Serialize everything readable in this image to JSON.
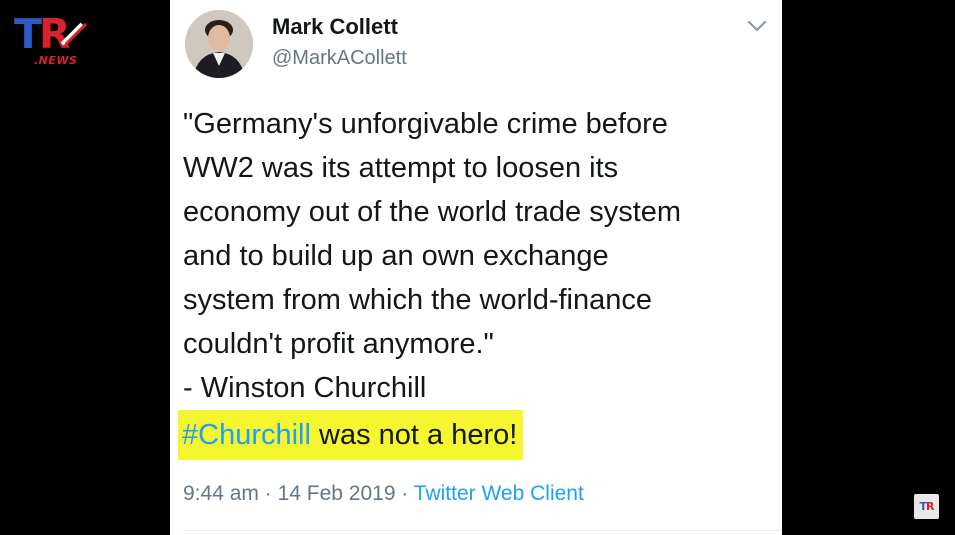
{
  "logo": {
    "letters_t": "T",
    "letters_r": "R",
    "sub": ".NEWS"
  },
  "watermark": {
    "t": "T",
    "r": "R"
  },
  "tweet": {
    "author_name": "Mark Collett",
    "author_handle": "@MarkACollett",
    "body_lines": [
      "\"Germany's unforgivable crime before",
      "WW2 was its attempt to loosen its",
      "economy out of the world trade system",
      "and to build up an own exchange",
      "system from which the world-finance",
      "couldn't profit anymore.\"",
      "- Winston Churchill"
    ],
    "hashtag": "#Churchill",
    "highlight_rest": " was not a hero!",
    "time": "9:44 am",
    "separator": " · ",
    "date": "14 Feb 2019",
    "client": "Twitter Web Client"
  },
  "colors": {
    "link_blue": "#1da1f2",
    "highlight_yellow": "#f5f530",
    "logo_blue": "#2f58c8",
    "logo_red": "#d8232a"
  },
  "icons": {
    "menu": "chevron-down-icon",
    "avatar": "avatar"
  }
}
